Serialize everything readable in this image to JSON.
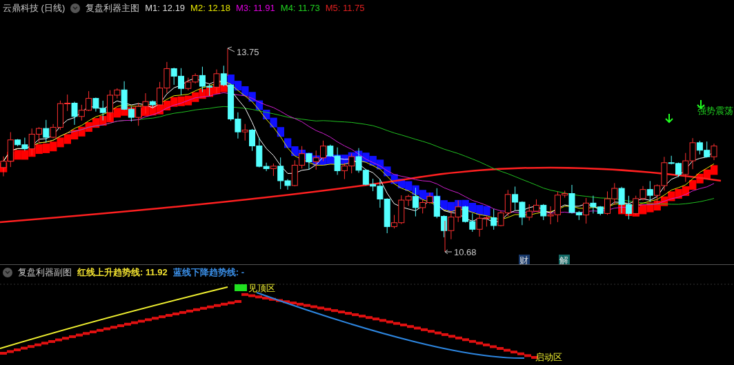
{
  "main_chart": {
    "title": "云鼎科技 (日线)",
    "indicator": "复盘利器主图",
    "ma_readings": [
      {
        "label": "M1: 12.19",
        "color": "#dcdcdc"
      },
      {
        "label": "M2: 12.18",
        "color": "#e8e800"
      },
      {
        "label": "M3: 11.91",
        "color": "#e000e0"
      },
      {
        "label": "M4: 11.73",
        "color": "#20d020"
      },
      {
        "label": "M5: 11.75",
        "color": "#e02020"
      }
    ],
    "high_label": "13.75",
    "low_label": "10.68",
    "signal_label": "强势震荡",
    "markers": [
      {
        "text": "财",
        "color": "#17386a"
      },
      {
        "text": "解",
        "color": "#136a66"
      }
    ]
  },
  "sub_chart": {
    "indicator": "复盘利器副图",
    "readings": [
      {
        "label": "红线上升趋势线: 11.92",
        "color": "#f0e030"
      },
      {
        "label": "蓝线下降趋势线: -",
        "color": "#3a8ee6"
      }
    ],
    "top_zone_label": "见顶区",
    "start_zone_label": "启动区"
  }
}
